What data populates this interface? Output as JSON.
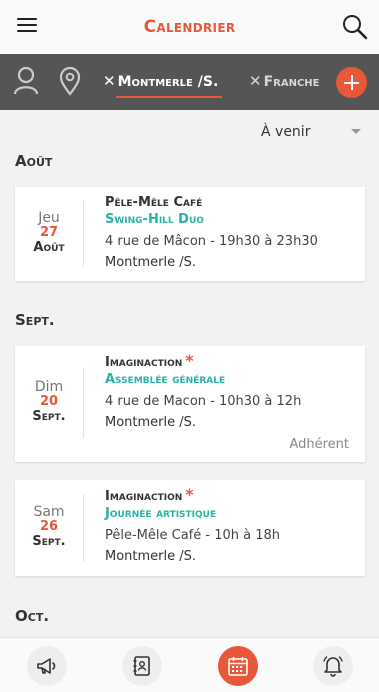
{
  "header": {
    "title": "Calendrier",
    "menu_icon": "hamburger-menu-icon",
    "search_icon": "search-icon"
  },
  "filters": {
    "user_icon": "user-icon",
    "location_icon": "map-pin-icon",
    "chips": [
      {
        "label": "Montmerle /S.",
        "active": true
      },
      {
        "label": "Franche",
        "active": false
      }
    ],
    "add_icon": "plus-icon"
  },
  "period_select": {
    "value": "À venir"
  },
  "months": [
    {
      "label": "Août"
    },
    {
      "label": "Sept."
    },
    {
      "label": "Oct."
    }
  ],
  "events": [
    {
      "dow": "Jeu",
      "day": "27",
      "month": "Août",
      "organizer": "Pêle-Mêle Café",
      "starred": false,
      "title": "Swing-Hill Duo",
      "address": "4 rue de Mâcon - 19h30 à 23h30",
      "city": "Montmerle /S.",
      "badge": ""
    },
    {
      "dow": "Dim",
      "day": "20",
      "month": "Sept.",
      "organizer": "Imaginaction",
      "starred": true,
      "star": "*",
      "title": "Assemblée générale",
      "address": "4 rue de Macon - 10h30 à 12h",
      "city": "Montmerle /S.",
      "badge": "Adhérent"
    },
    {
      "dow": "Sam",
      "day": "26",
      "month": "Sept.",
      "organizer": "Imaginaction",
      "starred": true,
      "star": "*",
      "title": "Journée artistique",
      "address": "Pêle-Mêle Café - 10h à 18h",
      "city": "Montmerle /S.",
      "badge": ""
    }
  ],
  "bottom_nav": [
    {
      "icon": "megaphone-icon",
      "active": false
    },
    {
      "icon": "address-book-icon",
      "active": false
    },
    {
      "icon": "calendar-icon",
      "active": true
    },
    {
      "icon": "bell-icon",
      "active": false
    }
  ],
  "colors": {
    "accent": "#e9573a",
    "teal": "#26b3a6",
    "bar": "#555555"
  }
}
